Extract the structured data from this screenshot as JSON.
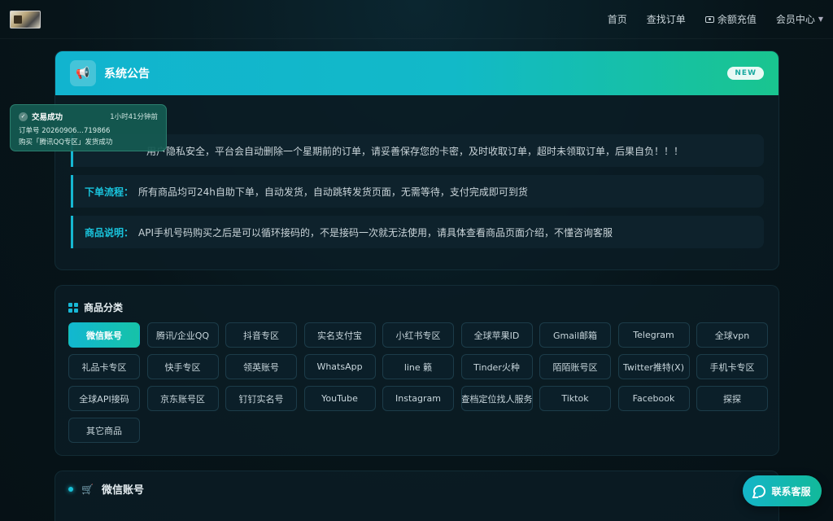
{
  "nav": {
    "items": [
      "首页",
      "查找订单",
      "余额充值",
      "会员中心"
    ]
  },
  "notice": {
    "title": "系统公告",
    "badge": "NEW",
    "rows": [
      {
        "label": "",
        "text": "用户隐私安全，平台会自动删除一个星期前的订单，请妥善保存您的卡密，及时收取订单，超时未领取订单，后果自负！！！"
      },
      {
        "label": "下单流程：",
        "text": "所有商品均可24h自助下单，自动发货，自动跳转发货页面，无需等待，支付完成即可到货"
      },
      {
        "label": "商品说明：",
        "text": "API手机号码购买之后是可以循环接码的，不是接码一次就无法使用，请具体查看商品页面介绍，不懂咨询客服"
      }
    ]
  },
  "category": {
    "title": "商品分类",
    "active": "微信账号",
    "items": [
      "微信账号",
      "腾讯/企业QQ",
      "抖音专区",
      "实名支付宝",
      "小红书专区",
      "全球苹果ID",
      "Gmail邮箱",
      "Telegram",
      "全球vpn",
      "礼品卡专区",
      "快手专区",
      "领英账号",
      "WhatsApp",
      "line 籁",
      "Tinder火种",
      "陌陌账号区",
      "Twitter推特(X)",
      "手机卡专区",
      "全球API接码",
      "京东账号区",
      "钉钉实名号",
      "YouTube",
      "Instagram",
      "查档定位找人服务",
      "Tiktok",
      "Facebook",
      "探探",
      "其它商品"
    ]
  },
  "products": {
    "title": "微信账号"
  },
  "toast": {
    "status": "交易成功",
    "time": "1小时41分钟前",
    "order": "订单号 20260906…719866",
    "message": "购买「腾讯QQ专区」发货成功"
  },
  "contact": {
    "label": "联系客服"
  },
  "colors": {
    "accent": "#16b7d2",
    "accent_green": "#19c58f",
    "background": "#07151c"
  }
}
